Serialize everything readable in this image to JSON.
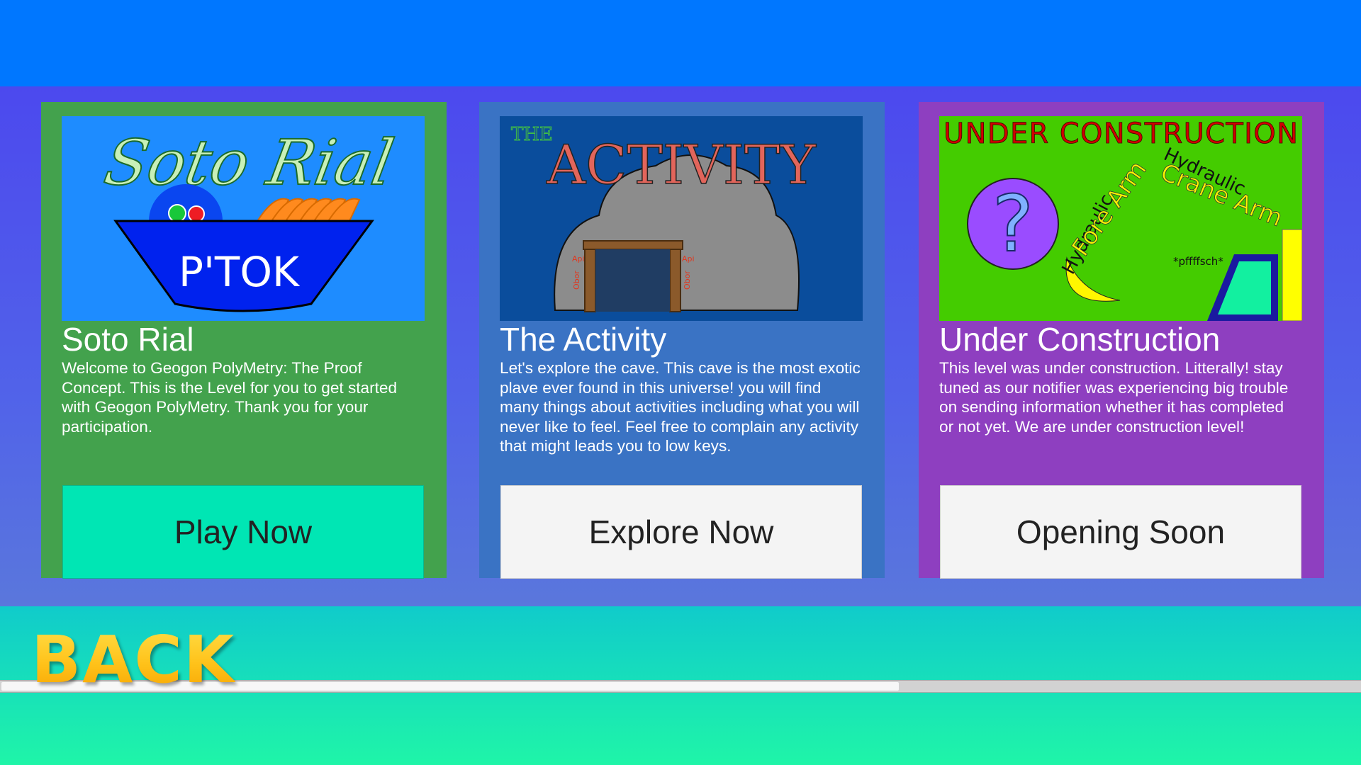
{
  "levels": [
    {
      "title": "Soto Rial",
      "description": "Welcome to Geogon PolyMetry: The Proof Concept. This is the Level for you to get started with Geogon PolyMetry. Thank you for your participation.",
      "button_label": "Play Now",
      "thumbnail": {
        "logo_text": "Soto Rial",
        "bowl_text": "P'TOK"
      },
      "card_color": "#43a24d"
    },
    {
      "title": "The Activity",
      "description": "Let's explore the cave. This cave is the most exotic plave ever found in this universe! you will find many things about activities including what you will never like to feel. Feel free to complain any activity that might leads you to low keys.",
      "button_label": "Explore Now",
      "thumbnail": {
        "small_title": "THE",
        "big_title": "ACTIVITY",
        "sign_top": "Api",
        "sign_side": "Obor"
      },
      "card_color": "#3a73c4"
    },
    {
      "title": "Under Construction",
      "description": "This level was under construction. Litterally! stay tuned as our notifier was experiencing big trouble on sending information whether it has completed or not yet. We are under construction level!",
      "button_label": "Opening Soon",
      "thumbnail": {
        "banner": "UNDER CONSTRUCTION",
        "arm_a": "Hydraulic",
        "arm_b": "Fore Arm",
        "arm_c": "Hydraulic",
        "arm_d": "Crane Arm",
        "sound": "*pffffsch*",
        "question": "?"
      },
      "card_color": "#8e3fc0"
    }
  ],
  "back_label": "BACK",
  "colors": {
    "header": "#0077ff",
    "accent_button": "#00e6b4",
    "back_text": "#ffc21a"
  }
}
